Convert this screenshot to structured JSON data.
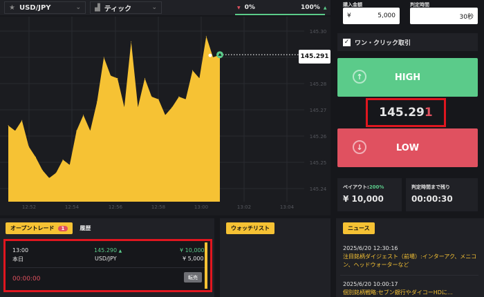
{
  "topbar": {
    "pair": "USD/JPY",
    "chart_type": "ティック",
    "left_pct": "0%",
    "right_pct": "100%"
  },
  "chart": {
    "y_ticks": [
      "145.30",
      "145.29",
      "145.28",
      "145.27",
      "145.26",
      "145.25",
      "145.24"
    ],
    "x_ticks": [
      "12:52",
      "12:54",
      "12:56",
      "12:58",
      "13:00",
      "13:02",
      "13:04"
    ],
    "current_price": "145.291",
    "accent": "#f6c234"
  },
  "chart_data": {
    "type": "area",
    "x_label_range": [
      "12:52",
      "13:04"
    ],
    "ylim": [
      145.235,
      145.305
    ],
    "series": [
      {
        "values": [
          145.264,
          145.262,
          145.266,
          145.256,
          145.252,
          145.247,
          145.244,
          145.246,
          145.251,
          145.249,
          145.262,
          145.268,
          145.262,
          145.273,
          145.29,
          145.283,
          145.282,
          145.271,
          145.296,
          145.271,
          145.282,
          145.275,
          145.274,
          145.268,
          145.271,
          145.275,
          145.274,
          145.285,
          145.282,
          145.298,
          145.29,
          145.291
        ]
      }
    ]
  },
  "sidebar": {
    "amount_label": "購入金額",
    "amount_currency": "¥",
    "amount_value": "5,000",
    "duration_label": "判定時間",
    "duration_value": "30秒",
    "one_click_label": "ワン・クリック取引",
    "high_label": "HIGH",
    "price_main": "145.29",
    "price_last": "1",
    "low_label": "LOW",
    "payout_label": "ペイアウト:",
    "payout_pct": "200%",
    "payout_value": "¥ 10,000",
    "time_left_label": "判定時間まで残り",
    "time_left_value": "00:00:30"
  },
  "trades": {
    "tab_open": "オープントレード",
    "tab_open_count": "1",
    "tab_history": "履歴",
    "row": {
      "time": "13:00",
      "day": "本日",
      "price": "145.290",
      "pair": "USD/JPY",
      "payout": "¥ 10,000",
      "stake": "¥ 5,000",
      "countdown": "00:00:00",
      "resell": "転売"
    }
  },
  "watchlist": {
    "title": "ウォッチリスト"
  },
  "news": {
    "title": "ニュース",
    "items": [
      {
        "time": "2025/6/20 12:30:16",
        "headline": "注目銘柄ダイジェスト（前場）:インターアク、メニコン、ヘッドウォーターなど"
      },
      {
        "time": "2025/6/20 10:00:17",
        "headline": "個別銘柄戦略:セブン銀行やダイコーHDに…"
      }
    ]
  }
}
